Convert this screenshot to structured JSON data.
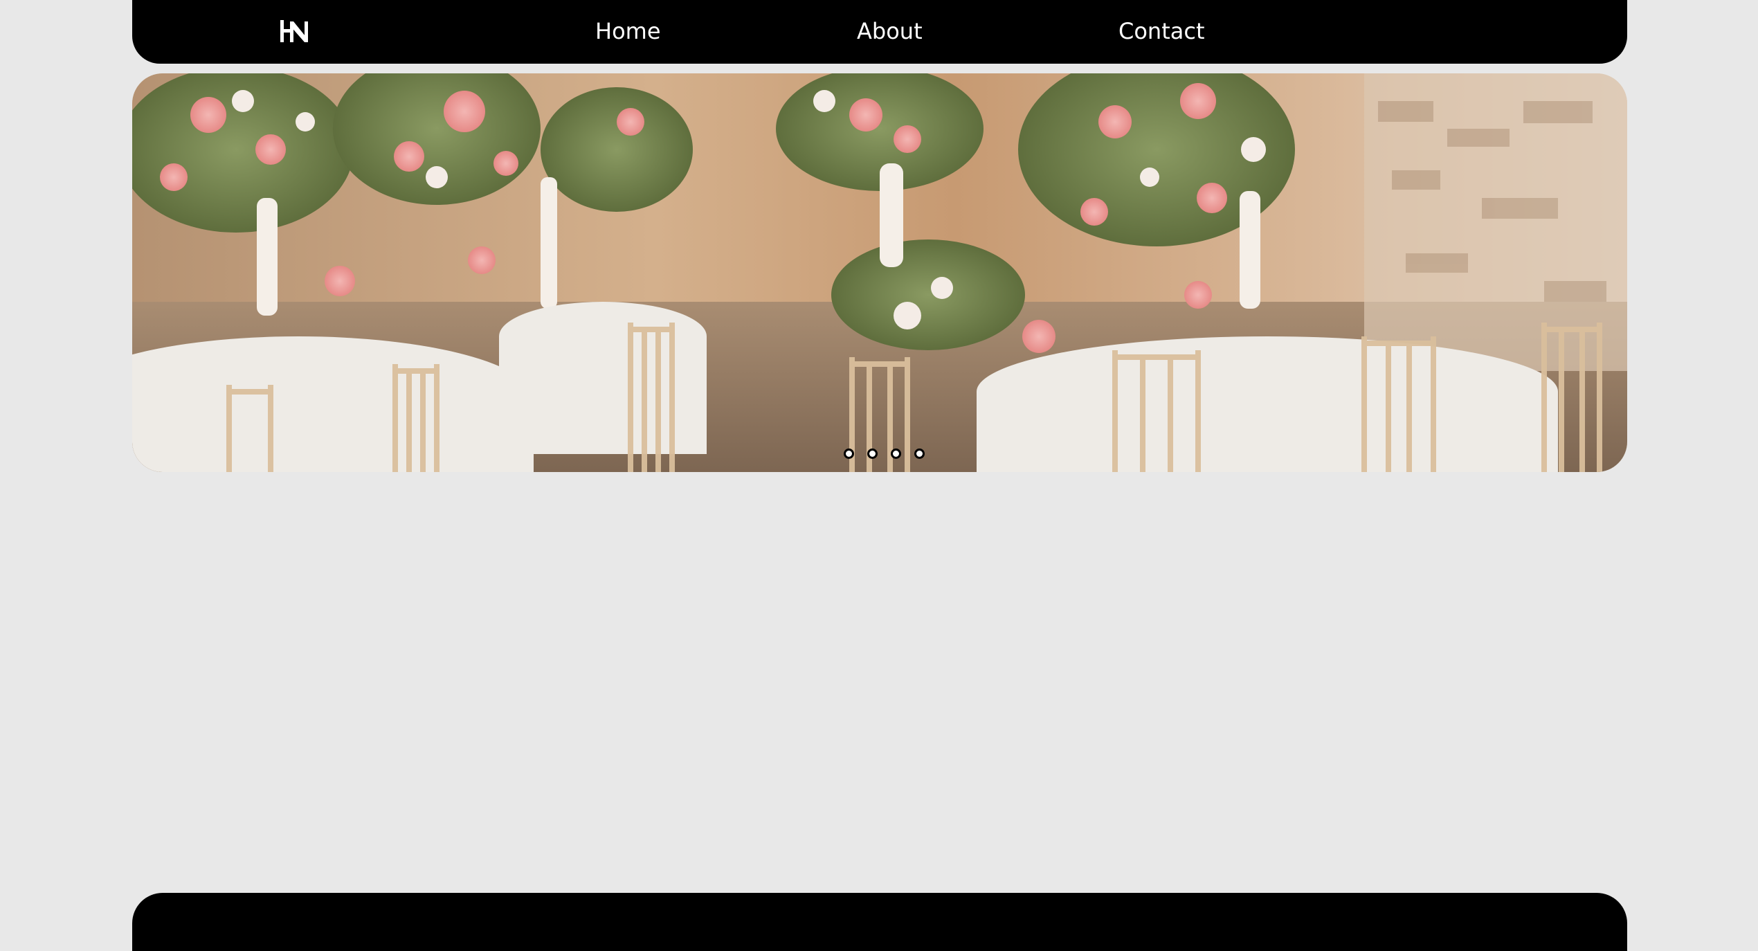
{
  "nav": {
    "logo_text": "HN",
    "links": [
      {
        "label": "Home"
      },
      {
        "label": "About"
      },
      {
        "label": "Contact"
      }
    ]
  },
  "hero": {
    "image_subject": "wedding-reception-venue",
    "slide_count": 4
  },
  "colors": {
    "page_background": "#e8e8e8",
    "bar_background": "#000000",
    "nav_text": "#ffffff"
  }
}
